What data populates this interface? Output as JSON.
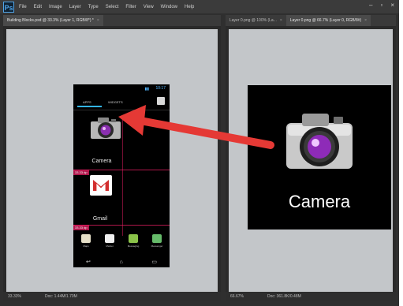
{
  "app": {
    "logo": "Ps",
    "menu": [
      "File",
      "Edit",
      "Image",
      "Layer",
      "Type",
      "Select",
      "Filter",
      "View",
      "Window",
      "Help"
    ]
  },
  "window_controls": [
    "–",
    "▫",
    "×"
  ],
  "left_doc": {
    "tab": "Building Blocks.psd @ 33.3% (Layer 1, RGB/8*) *",
    "status_zoom": "33.33%",
    "status_doc": "Doc: 1.44M/1.70M",
    "phone": {
      "time": "10:17",
      "tabs": [
        "APPS",
        "WIDGETS"
      ],
      "apps": [
        {
          "label": "Camera"
        },
        {
          "label": "Gmail"
        }
      ],
      "bottom_apps": [
        "Maps",
        "Market",
        "Messaging",
        "Messenger"
      ],
      "guide_badges": [
        "33.33 dp",
        "33.33 dp"
      ]
    }
  },
  "right_doc": {
    "tabs": [
      "Layer 0.png @ 100% (La...",
      "Layer 0.png @ 66.7% (Layer 0, RGB/8#)"
    ],
    "status_zoom": "66.67%",
    "status_doc": "Doc: 361.8K/0.48M",
    "artwork": {
      "label": "Camera"
    }
  },
  "colors": {
    "arrow": "#e53935",
    "canvas": "#c3c6c9",
    "guide": "#e91e63",
    "accent": "#33b5e5"
  },
  "icons": [
    "photoshop-logo-icon",
    "camera-icon",
    "gmail-icon",
    "maps-icon",
    "market-icon",
    "messaging-icon",
    "messenger-icon",
    "back-icon",
    "home-icon",
    "recents-icon",
    "arrow-icon"
  ]
}
